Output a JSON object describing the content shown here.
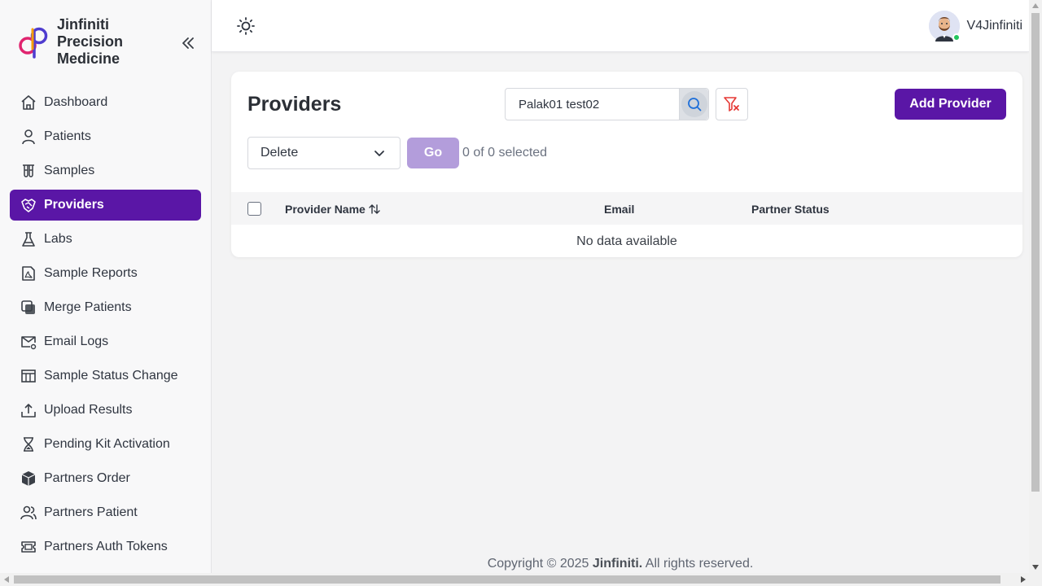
{
  "brand": {
    "name": "Jinfiniti Precision Medicine"
  },
  "sidebar": {
    "items": [
      {
        "label": "Dashboard",
        "icon": "home-icon"
      },
      {
        "label": "Patients",
        "icon": "user-icon"
      },
      {
        "label": "Samples",
        "icon": "test-tubes-icon"
      },
      {
        "label": "Providers",
        "icon": "handshake-icon",
        "active": true
      },
      {
        "label": "Labs",
        "icon": "flask-icon"
      },
      {
        "label": "Sample Reports",
        "icon": "pdf-file-icon"
      },
      {
        "label": "Merge Patients",
        "icon": "merge-icon"
      },
      {
        "label": "Email Logs",
        "icon": "mail-gear-icon"
      },
      {
        "label": "Sample Status Change",
        "icon": "table-icon"
      },
      {
        "label": "Upload Results",
        "icon": "upload-icon"
      },
      {
        "label": "Pending Kit Activation",
        "icon": "hourglass-icon"
      },
      {
        "label": "Partners Order",
        "icon": "box-icon"
      },
      {
        "label": "Partners Patient",
        "icon": "users-icon"
      },
      {
        "label": "Partners Auth Tokens",
        "icon": "ticket-icon"
      }
    ]
  },
  "header": {
    "username": "V4Jinfiniti"
  },
  "main": {
    "title": "Providers",
    "search": {
      "value": "Palak01 test02"
    },
    "add_button": "Add Provider",
    "bulk_action": {
      "selected": "Delete",
      "go_label": "Go",
      "selection_text": "0 of 0 selected"
    },
    "table": {
      "columns": [
        "Provider Name",
        "Email",
        "Partner Status"
      ],
      "empty_text": "No data available"
    }
  },
  "footer": {
    "prefix": "Copyright © 2025",
    "company": "Jinfiniti.",
    "suffix": "All rights reserved."
  },
  "colors": {
    "accent": "#5a16a6",
    "go_disabled": "#b39ddb",
    "filter_clear": "#e53935",
    "online": "#22c55e"
  }
}
